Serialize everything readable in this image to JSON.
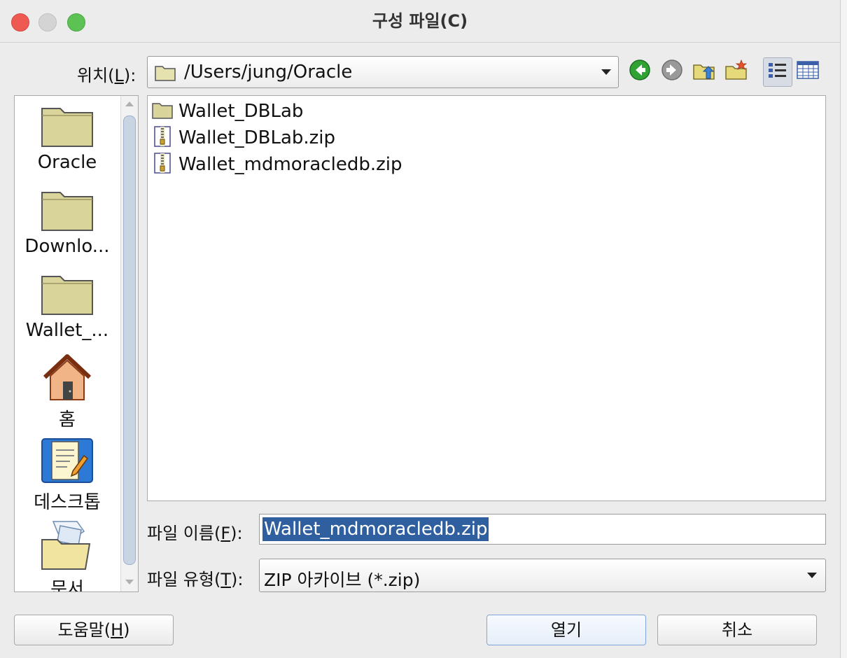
{
  "window": {
    "title": "구성 파일(C)"
  },
  "location": {
    "label_before": "위치(",
    "mnemonic": "L",
    "label_after": "):",
    "path": "/Users/jung/Oracle"
  },
  "toolbar": {
    "icons": [
      "back-icon",
      "forward-icon",
      "up-folder-icon",
      "new-folder-icon",
      "list-view-icon",
      "details-view-icon"
    ]
  },
  "sidebar": {
    "items": [
      {
        "label": "Oracle",
        "icon": "folder-icon"
      },
      {
        "label": "Downlo...",
        "icon": "folder-icon"
      },
      {
        "label": "Wallet_...",
        "icon": "folder-icon"
      },
      {
        "label": "홈",
        "icon": "home-icon"
      },
      {
        "label": "데스크톱",
        "icon": "desktop-icon"
      },
      {
        "label": "문서",
        "icon": "documents-icon"
      }
    ]
  },
  "files": [
    {
      "name": "Wallet_DBLab",
      "icon": "folder-icon"
    },
    {
      "name": "Wallet_DBLab.zip",
      "icon": "zip-file-icon"
    },
    {
      "name": "Wallet_mdmoracledb.zip",
      "icon": "zip-file-icon"
    }
  ],
  "filename": {
    "label_before": "파일 이름(",
    "mnemonic": "F",
    "label_after": "):",
    "value": "Wallet_mdmoracledb.zip"
  },
  "filetype": {
    "label_before": "파일 유형(",
    "mnemonic": "T",
    "label_after": "):",
    "value": "ZIP 아카이브 (*.zip)"
  },
  "buttons": {
    "help_before": "도움말(",
    "help_mnemonic": "H",
    "help_after": ")",
    "open": "열기",
    "cancel": "취소"
  },
  "colors": {
    "selection": "#2f5f9e",
    "folder": "#d8d49a"
  }
}
